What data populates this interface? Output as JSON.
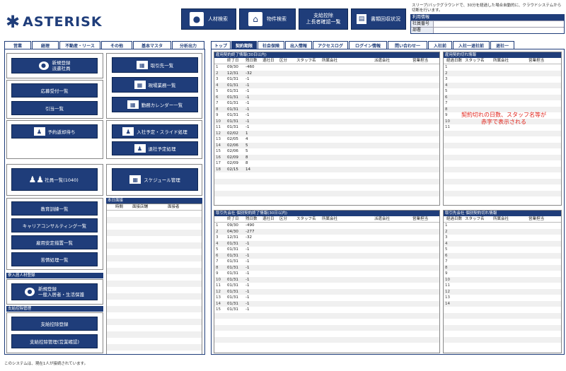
{
  "app": {
    "logo_text": "ASTERISK",
    "logo_icon": "asterisk-star-icon"
  },
  "header_buttons": [
    {
      "label": "人材検索",
      "icon": "person-icon"
    },
    {
      "label": "物件検索",
      "icon": "house-icon"
    },
    {
      "label": "支給控除\n上長者確認一覧",
      "icon": ""
    },
    {
      "label": "書類回収状況",
      "icon": "document-icon"
    }
  ],
  "notice": "スリープ/バックグラウンドで、30分を経過した場合自動的に、クラウドシステムから切断を行います。",
  "user_info": {
    "title": "利用情報",
    "rows": [
      {
        "k": "社員番号",
        "v": ""
      },
      {
        "k": "部署",
        "v": ""
      }
    ]
  },
  "left_tabs": [
    "営業",
    "経理",
    "不動産・リース",
    "その他",
    "基本マスタ",
    "分析出力"
  ],
  "left_buttons": {
    "new_dispatch": "新規登録\n派遣社員",
    "client_list": "取引先一覧",
    "workplace_list": "現場業務一覧",
    "work_calendar": "勤務カレンダー一覧",
    "applications": "応募受付一覧",
    "handover": "引当一覧",
    "reservation": "予約返却待ち",
    "joining": "入社予定・スライド処理",
    "leaving": "退社予定処理",
    "employees": "社員一覧(1040)",
    "schedule": "スケジュール管理",
    "education": "教育訓練一覧",
    "career": "キャリアコンサルティング一覧",
    "employment_stability": "雇用安定措置一覧",
    "complaints": "苦情処理一覧",
    "new_general": "新規登録\n一般入居者・生活保護",
    "pay_register": "支給控除登録",
    "pay_manage": "支給控除管理(営業確認)"
  },
  "left_sections": {
    "residents": "寮入居人材登録",
    "pay": "支給控除管理"
  },
  "interview": {
    "title": "本日面接",
    "cols": [
      "時間",
      "面接店舗",
      "面接者"
    ]
  },
  "right_tabs": [
    "トップ",
    "契約期限",
    "社会保険",
    "出入情報",
    "アクセスログ",
    "ログイン情報",
    "問い合わせ一",
    "入社前",
    "入社一退社前",
    "退社一"
  ],
  "table1": {
    "title": "雇用契約終了情報(30日以内)",
    "cols": [
      "終了日",
      "残日数",
      "退社日",
      "区分",
      "スタッフ名",
      "所属会社",
      "派遣会社",
      "営業担当"
    ],
    "rows": [
      [
        "1",
        "09/30",
        "-460"
      ],
      [
        "2",
        "12/31",
        "-32"
      ],
      [
        "3",
        "01/31",
        "-1"
      ],
      [
        "4",
        "01/31",
        "-1"
      ],
      [
        "5",
        "01/31",
        "-1"
      ],
      [
        "6",
        "01/31",
        "-1"
      ],
      [
        "7",
        "01/31",
        "-1"
      ],
      [
        "8",
        "01/31",
        "-1"
      ],
      [
        "9",
        "01/31",
        "-1"
      ],
      [
        "10",
        "01/31",
        "-1"
      ],
      [
        "11",
        "01/31",
        "-1"
      ],
      [
        "12",
        "02/02",
        "1"
      ],
      [
        "13",
        "02/05",
        "4"
      ],
      [
        "14",
        "02/06",
        "5"
      ],
      [
        "15",
        "02/06",
        "5"
      ],
      [
        "16",
        "02/09",
        "8"
      ],
      [
        "17",
        "02/09",
        "8"
      ],
      [
        "18",
        "02/15",
        "14"
      ]
    ]
  },
  "table2": {
    "title": "雇用契約切れ情報",
    "cols": [
      "経過日数",
      "スタッフ名",
      "所属会社",
      "営業担当"
    ],
    "rows": [
      "1",
      "2",
      "3",
      "4",
      "5",
      "6",
      "7",
      "8",
      "9",
      "10",
      "11"
    ],
    "note": "契約切れの日数、スタッフ名等が\n赤字で表示される"
  },
  "table3": {
    "title": "取引先会社 個別契約終了情報(30日以内)",
    "cols": [
      "終了日",
      "残日数",
      "退社日",
      "区分",
      "スタッフ名",
      "所属会社",
      "派遣会社",
      "営業担当"
    ],
    "rows": [
      [
        "1",
        "09/30",
        "-490"
      ],
      [
        "2",
        "04/30",
        "-277"
      ],
      [
        "3",
        "12/31",
        "-32"
      ],
      [
        "4",
        "01/31",
        "-1"
      ],
      [
        "5",
        "01/31",
        "-1"
      ],
      [
        "6",
        "01/31",
        "-1"
      ],
      [
        "7",
        "01/31",
        "-1"
      ],
      [
        "8",
        "01/31",
        "-1"
      ],
      [
        "9",
        "01/31",
        "-1"
      ],
      [
        "10",
        "01/31",
        "-1"
      ],
      [
        "11",
        "01/31",
        "-1"
      ],
      [
        "12",
        "01/31",
        "-1"
      ],
      [
        "13",
        "01/31",
        "-1"
      ],
      [
        "14",
        "01/31",
        "-1"
      ],
      [
        "15",
        "01/31",
        "-1"
      ]
    ]
  },
  "table4": {
    "title": "取引先会社 個別契約切れ情報",
    "cols": [
      "経過日数",
      "スタッフ名",
      "所属会社",
      "営業担当"
    ],
    "rows": [
      "1",
      "2",
      "3",
      "4",
      "5",
      "6",
      "7",
      "8",
      "9",
      "10",
      "11",
      "12",
      "13",
      "14"
    ]
  },
  "footer": "このシステムは、現在1人が接続されています。"
}
